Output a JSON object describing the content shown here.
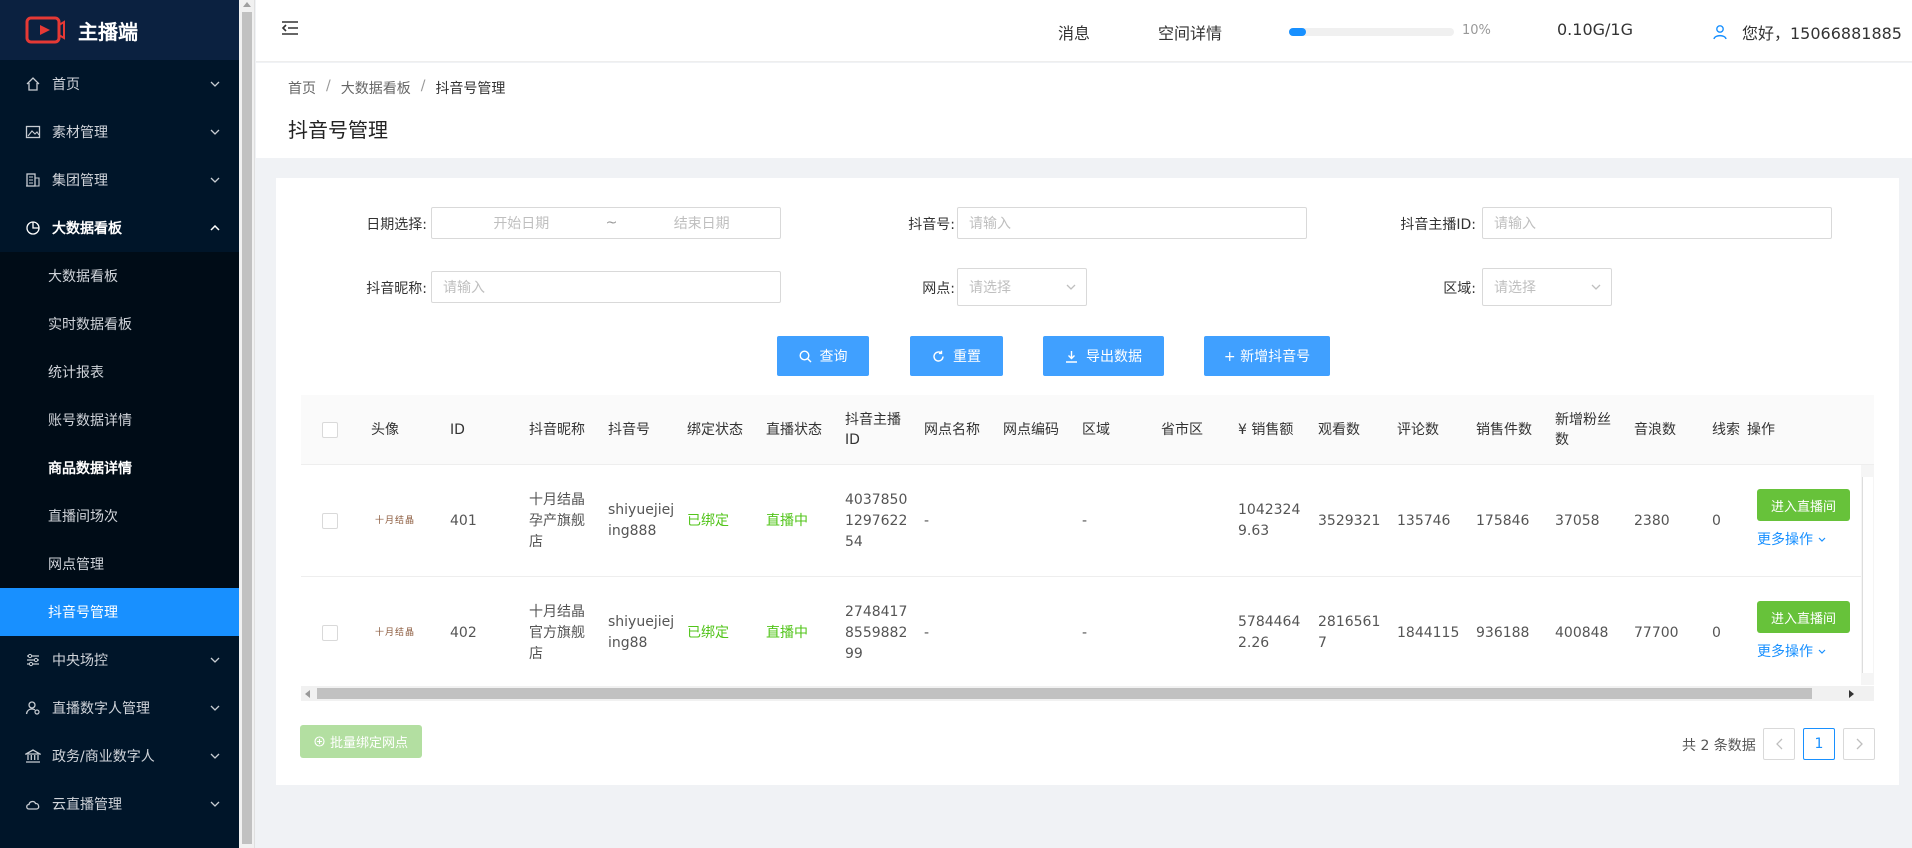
{
  "app": {
    "name": "主播端"
  },
  "sidebar": {
    "items": [
      {
        "label": "首页",
        "icon": "home-icon"
      },
      {
        "label": "素材管理",
        "icon": "image-icon"
      },
      {
        "label": "集团管理",
        "icon": "building-icon"
      },
      {
        "label": "大数据看板",
        "icon": "pie-chart-icon",
        "open": true
      }
    ],
    "sub_items": [
      {
        "label": "大数据看板"
      },
      {
        "label": "实时数据看板"
      },
      {
        "label": "统计报表"
      },
      {
        "label": "账号数据详情"
      },
      {
        "label": "商品数据详情"
      },
      {
        "label": "直播间场次"
      },
      {
        "label": "网点管理"
      },
      {
        "label": "抖音号管理",
        "active": true
      }
    ],
    "items_after": [
      {
        "label": "中央场控",
        "icon": "sliders-icon"
      },
      {
        "label": "直播数字人管理",
        "icon": "user-gear-icon"
      },
      {
        "label": "政务/商业数字人",
        "icon": "bank-icon"
      },
      {
        "label": "云直播管理",
        "icon": "cloud-icon"
      }
    ]
  },
  "header": {
    "messages": "消息",
    "space_detail": "空间详情",
    "progress": 10,
    "progress_text": "10%",
    "storage": "0.10G/1G",
    "greeting": "您好，15066881885"
  },
  "breadcrumb": {
    "home": "首页",
    "parent": "大数据看板",
    "current": "抖音号管理"
  },
  "page_title": "抖音号管理",
  "filters": {
    "date_label": "日期选择:",
    "date_start_placeholder": "开始日期",
    "date_sep": "~",
    "date_end_placeholder": "结束日期",
    "douyin_label": "抖音号:",
    "douyin_placeholder": "请输入",
    "anchor_id_label": "抖音主播ID:",
    "anchor_id_placeholder": "请输入",
    "nickname_label": "抖音昵称:",
    "nickname_placeholder": "请输入",
    "branch_label": "网点:",
    "branch_placeholder": "请选择",
    "region_label": "区域:",
    "region_placeholder": "请选择"
  },
  "actions": {
    "query": "查询",
    "reset": "重置",
    "export": "导出数据",
    "add": "+ 新增抖音号"
  },
  "table": {
    "headers": {
      "avatar": "头像",
      "id": "ID",
      "nickname": "抖音昵称",
      "account": "抖音号",
      "bind_status": "绑定状态",
      "live_status": "直播状态",
      "anchor_id_1": "抖音主播",
      "anchor_id_2": "ID",
      "branch_name": "网点名称",
      "branch_code": "网点编码",
      "region": "区域",
      "province": "省市区",
      "sales": "¥ 销售额",
      "views": "观看数",
      "comments": "评论数",
      "sold": "销售件数",
      "new_fans_1": "新增粉丝",
      "new_fans_2": "数",
      "waves": "音浪数",
      "leads": "线索",
      "ops": "操作"
    },
    "rows": [
      {
        "avatar": "十月结晶",
        "id": "401",
        "nickname": [
          "十月结晶",
          "孕产旗舰",
          "店"
        ],
        "account": [
          "shiyuejiej",
          "ing888"
        ],
        "bind_status": "已绑定",
        "live_status": "直播中",
        "anchor_id": [
          "4037850",
          "1297622",
          "54"
        ],
        "branch_name": "-",
        "branch_code": "",
        "region": "-",
        "province": "",
        "sales": [
          "1042324",
          "9.63"
        ],
        "views": [
          "3529321"
        ],
        "comments": "135746",
        "sold": "175846",
        "new_fans": "37058",
        "waves": "2380",
        "leads": "0",
        "live_btn": "进入直播间",
        "more": "更多操作"
      },
      {
        "avatar": "十月结晶",
        "id": "402",
        "nickname": [
          "十月结晶",
          "官方旗舰",
          "店"
        ],
        "account": [
          "shiyuejiej",
          "ing88"
        ],
        "bind_status": "已绑定",
        "live_status": "直播中",
        "anchor_id": [
          "2748417",
          "8559882",
          "99"
        ],
        "branch_name": "-",
        "branch_code": "",
        "region": "-",
        "province": "",
        "sales": [
          "5784464",
          "2.26"
        ],
        "views": [
          "2816561",
          "7"
        ],
        "comments": "1844115",
        "sold": "936188",
        "new_fans": "400848",
        "waves": "77700",
        "leads": "0",
        "live_btn": "进入直播间",
        "more": "更多操作"
      }
    ]
  },
  "batch_button": "批量绑定网点",
  "pagination": {
    "total_text": "共 2 条数据",
    "current_page": "1"
  },
  "colors": {
    "primary": "#1890ff",
    "sidebar_bg": "#001529",
    "success": "#52c41a",
    "live_button": "#67c23a"
  }
}
